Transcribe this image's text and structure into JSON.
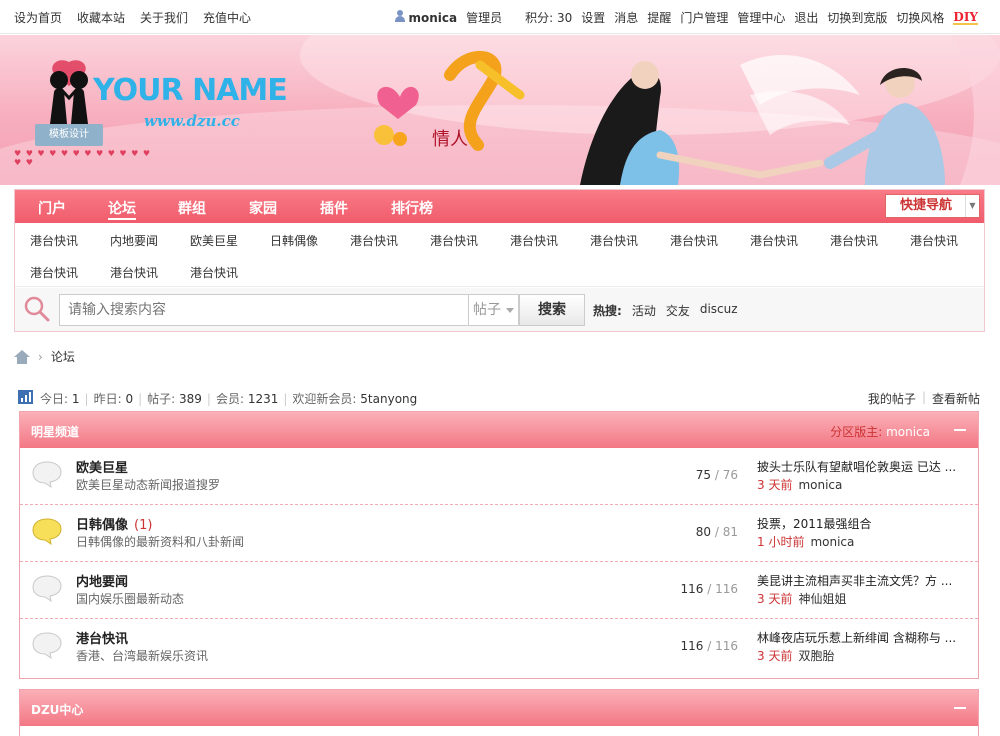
{
  "topbar": {
    "left_links": [
      "设为首页",
      "收藏本站",
      "关于我们",
      "充值中心"
    ],
    "user": "monica",
    "right_links": [
      "管理员",
      "积分: 30",
      "设置",
      "消息",
      "提醒",
      "门户管理",
      "管理中心",
      "退出",
      "切换到宽版",
      "切换风格"
    ],
    "diy": "DIY"
  },
  "banner": {
    "logo_text": "YOUR NAME",
    "logo_url": "www.dzu.cc",
    "logo_tag": "模板设计",
    "colors": {
      "logo": "#2fb2e8",
      "bg": "#f7aebe"
    }
  },
  "mainnav": {
    "items": [
      "门户",
      "论坛",
      "群组",
      "家园",
      "插件",
      "排行榜"
    ],
    "active": "论坛",
    "quick_nav": "快捷导航",
    "accent": "#f05c6c"
  },
  "subnav": {
    "row1": [
      "港台快讯",
      "内地要闻",
      "欧美巨星",
      "日韩偶像",
      "港台快讯",
      "港台快讯",
      "港台快讯",
      "港台快讯",
      "港台快讯",
      "港台快讯",
      "港台快讯",
      "港台快讯"
    ],
    "row2": [
      "港台快讯",
      "港台快讯",
      "港台快讯"
    ]
  },
  "search": {
    "placeholder": "请输入搜索内容",
    "type": "帖子",
    "button": "搜索",
    "hot_label": "热搜:",
    "hot_words": [
      "活动",
      "交友",
      "discuz"
    ]
  },
  "breadcrumb": {
    "separator": "›",
    "current": "论坛"
  },
  "stats": {
    "today_label": "今日:",
    "today": "1",
    "yesterday_label": "昨日:",
    "yesterday": "0",
    "posts_label": "帖子:",
    "posts": "389",
    "members_label": "会员:",
    "members": "1231",
    "welcome_label": "欢迎新会员:",
    "new_member": "5tanyong",
    "my_posts": "我的帖子",
    "new_posts": "查看新帖"
  },
  "sections": [
    {
      "title": "明星频道",
      "moderator_label": "分区版主:",
      "moderator": "monica",
      "forums": [
        {
          "name": "欧美巨星",
          "new": "",
          "desc": "欧美巨星动态新闻报道搜罗",
          "today": "75",
          "total": "76",
          "last_title": "披头士乐队有望献唱伦敦奥运 已达 ...",
          "last_time": "3 天前",
          "last_user": "monica",
          "active": false
        },
        {
          "name": "日韩偶像",
          "new": "(1)",
          "desc": "日韩偶像的最新资料和八卦新闻",
          "today": "80",
          "total": "81",
          "last_title": "投票，2011最强组合",
          "last_time": "1 小时前",
          "last_user": "monica",
          "active": true
        },
        {
          "name": "内地要闻",
          "new": "",
          "desc": "国内娱乐圈最新动态",
          "today": "116",
          "total": "116",
          "last_title": "美昆讲主流相声买非主流文凭？方 ...",
          "last_time": "3 天前",
          "last_user": "神仙姐姐",
          "active": false
        },
        {
          "name": "港台快讯",
          "new": "",
          "desc": "香港、台湾最新娱乐资讯",
          "today": "116",
          "total": "116",
          "last_title": "林峰夜店玩乐惹上新绯闻 含糊称与 ...",
          "last_time": "3 天前",
          "last_user": "双胞胎",
          "active": false
        }
      ]
    },
    {
      "title": "DZU中心"
    }
  ]
}
